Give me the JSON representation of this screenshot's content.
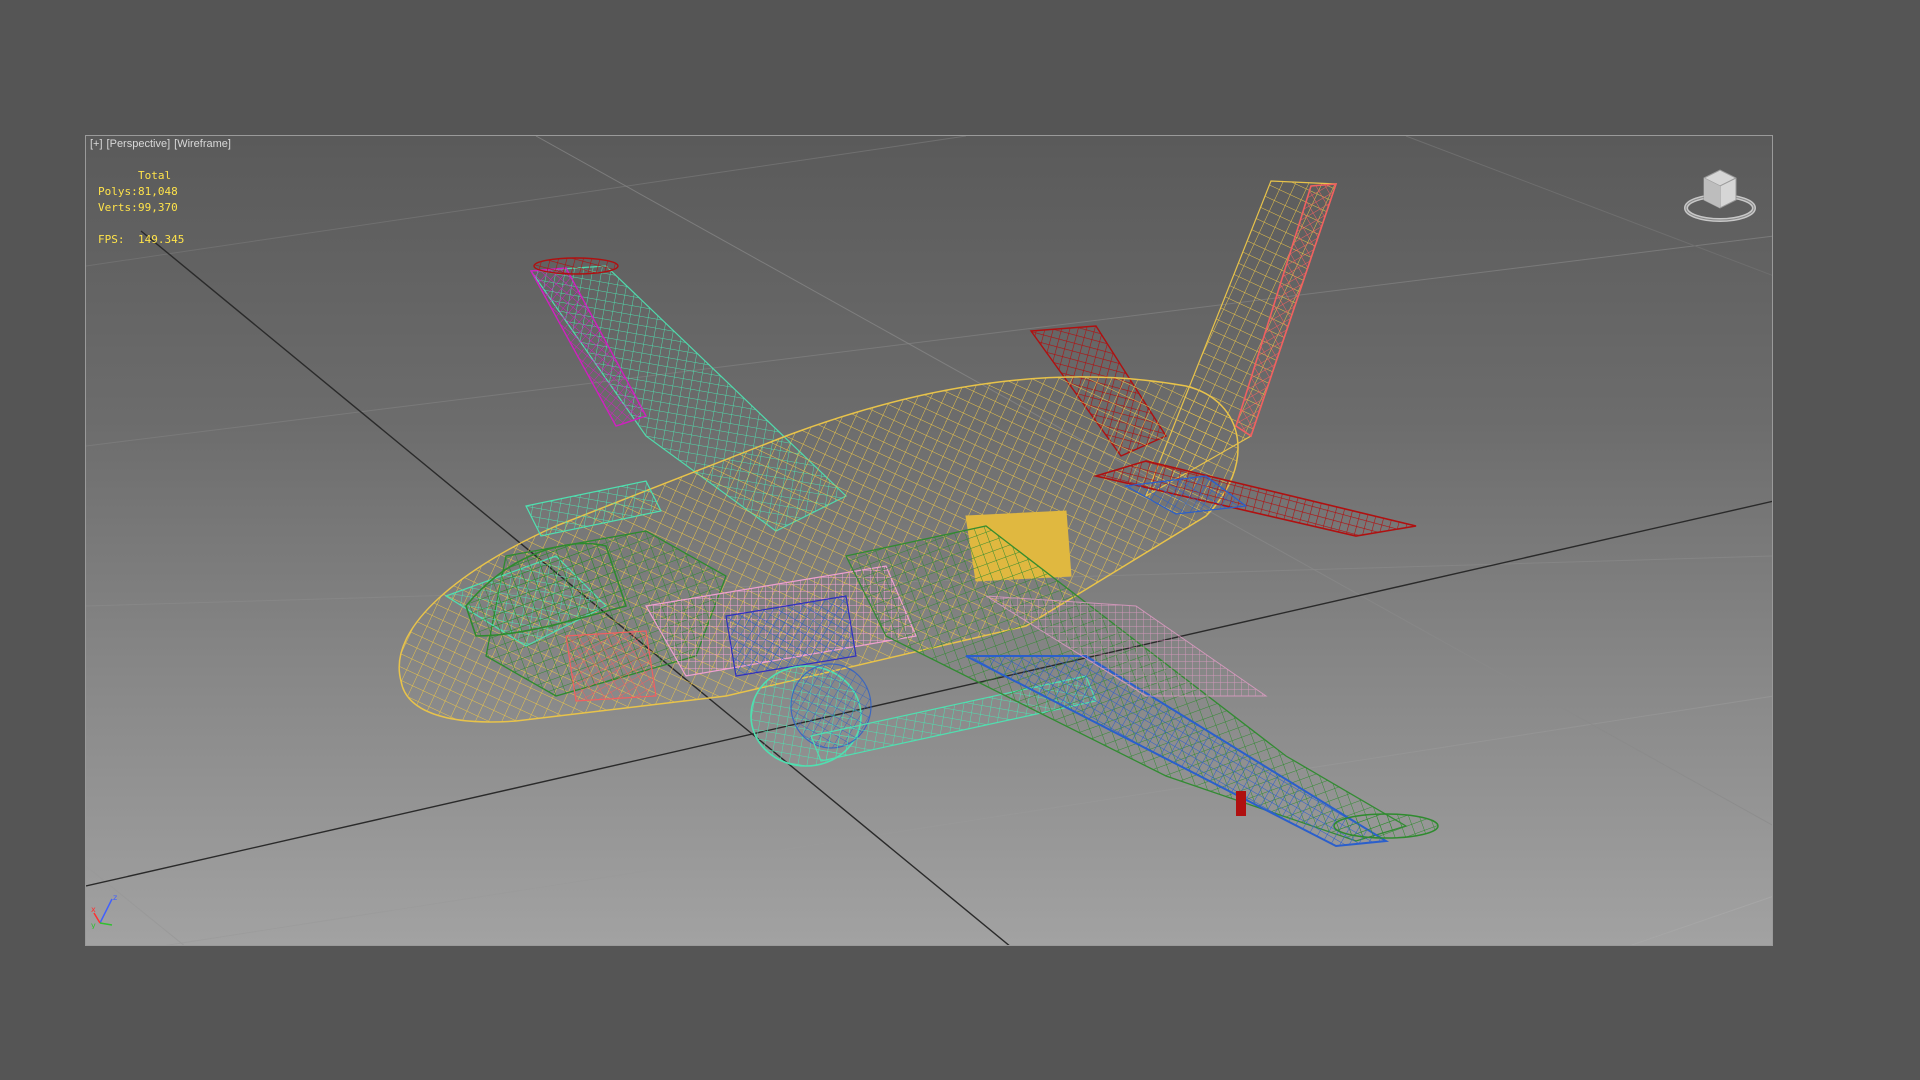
{
  "viewport": {
    "label_plus": "[+]",
    "label_view": "[Perspective]",
    "label_shading": "[Wireframe]",
    "stats": {
      "header": "Total",
      "polys_label": "Polys:",
      "polys_value": "81,048",
      "verts_label": "Verts:",
      "verts_value": "99,370",
      "fps_label": "FPS:",
      "fps_value": "149.345"
    },
    "axis": {
      "x": "x",
      "y": "y",
      "z": "z"
    }
  },
  "colors": {
    "background": "#555555",
    "stats_text": "#ffe34a",
    "fuselage": "#e8c34a",
    "wing_green": "#2e8b2e",
    "wing_blue": "#2a5fcc",
    "aqua": "#4fe0b0",
    "red": "#b01010",
    "salmon": "#f06060",
    "magenta": "#d020c0",
    "pink": "#f0a0d0"
  },
  "icons": {
    "viewcube": "viewcube-icon",
    "axis": "axis-tripod-icon"
  }
}
